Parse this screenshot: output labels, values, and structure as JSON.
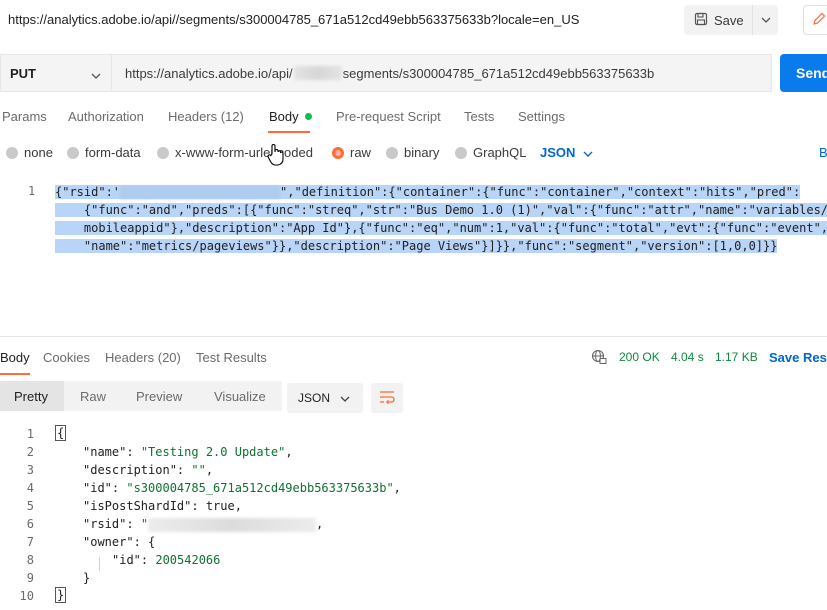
{
  "header": {
    "title_url": "https://analytics.adobe.io/api//segments/s300004785_671a512cd49ebb563375633b?locale=en_US",
    "save_label": "Save"
  },
  "request": {
    "method": "PUT",
    "url_prefix": "https://analytics.adobe.io/api/",
    "url_suffix": "segments/s300004785_671a512cd49ebb563375633b",
    "send_label": "Send"
  },
  "request_tabs": {
    "params": "Params",
    "authorization": "Authorization",
    "headers": "Headers (12)",
    "body": "Body",
    "prerequest": "Pre-request Script",
    "tests": "Tests",
    "settings": "Settings"
  },
  "body_types": {
    "none": "none",
    "form_data": "form-data",
    "urlencoded": "x-www-form-urlencoded",
    "raw": "raw",
    "binary": "binary",
    "graphql": "GraphQL",
    "json": "JSON",
    "beautify": "B"
  },
  "editor": {
    "line_number": "1",
    "line1a": "{\"rsid\":'",
    "line1b": "\",\"definition\":{\"container\":{\"func\":\"container\",\"context\":\"hits\",\"pred\":",
    "line2": "    {\"func\":\"and\",\"preds\":[{\"func\":\"streq\",\"str\":\"Bus Demo 1.0 (1)\",\"val\":{\"func\":\"attr\",\"name\":\"variables/",
    "line3": "    mobileappid\"},\"description\":\"App Id\"},{\"func\":\"eq\",\"num\":1,\"val\":{\"func\":\"total\",\"evt\":{\"func\":\"event\",",
    "line4": "    \"name\":\"metrics/pageviews\"}},\"description\":\"Page Views\"}]}},\"func\":\"segment\",\"version\":[1,0,0]}}"
  },
  "response_tabs": {
    "body": "Body",
    "cookies": "Cookies",
    "headers": "Headers (20)",
    "test_results": "Test Results"
  },
  "response_status": {
    "status": "200 OK",
    "time": "4.04 s",
    "size": "1.17 KB",
    "save_response": "Save Resp"
  },
  "view_tabs": {
    "pretty": "Pretty",
    "raw": "Raw",
    "preview": "Preview",
    "visualize": "Visualize",
    "format": "JSON"
  },
  "response_lines": [
    {
      "n": "1",
      "text": "{"
    },
    {
      "n": "2",
      "key": "\"name\"",
      "sep": ": ",
      "val": "\"Testing 2.0 Update\"",
      "tail": ","
    },
    {
      "n": "3",
      "key": "\"description\"",
      "sep": ": ",
      "val": "\"\"",
      "tail": ","
    },
    {
      "n": "4",
      "key": "\"id\"",
      "sep": ": ",
      "val": "\"s300004785_671a512cd49ebb563375633b\"",
      "tail": ","
    },
    {
      "n": "5",
      "key": "\"isPostShardId\"",
      "sep": ": ",
      "val": "true",
      "tail": ","
    },
    {
      "n": "6",
      "key": "\"rsid\"",
      "sep": ": ",
      "val": "\"",
      "tail": ","
    },
    {
      "n": "7",
      "key": "\"owner\"",
      "sep": ": ",
      "val": "{",
      "tail": ""
    },
    {
      "n": "8",
      "key": "\"id\"",
      "sep": ": ",
      "val": "200542066",
      "tail": ""
    },
    {
      "n": "9",
      "text": "}"
    },
    {
      "n": "10",
      "text": "}"
    }
  ]
}
